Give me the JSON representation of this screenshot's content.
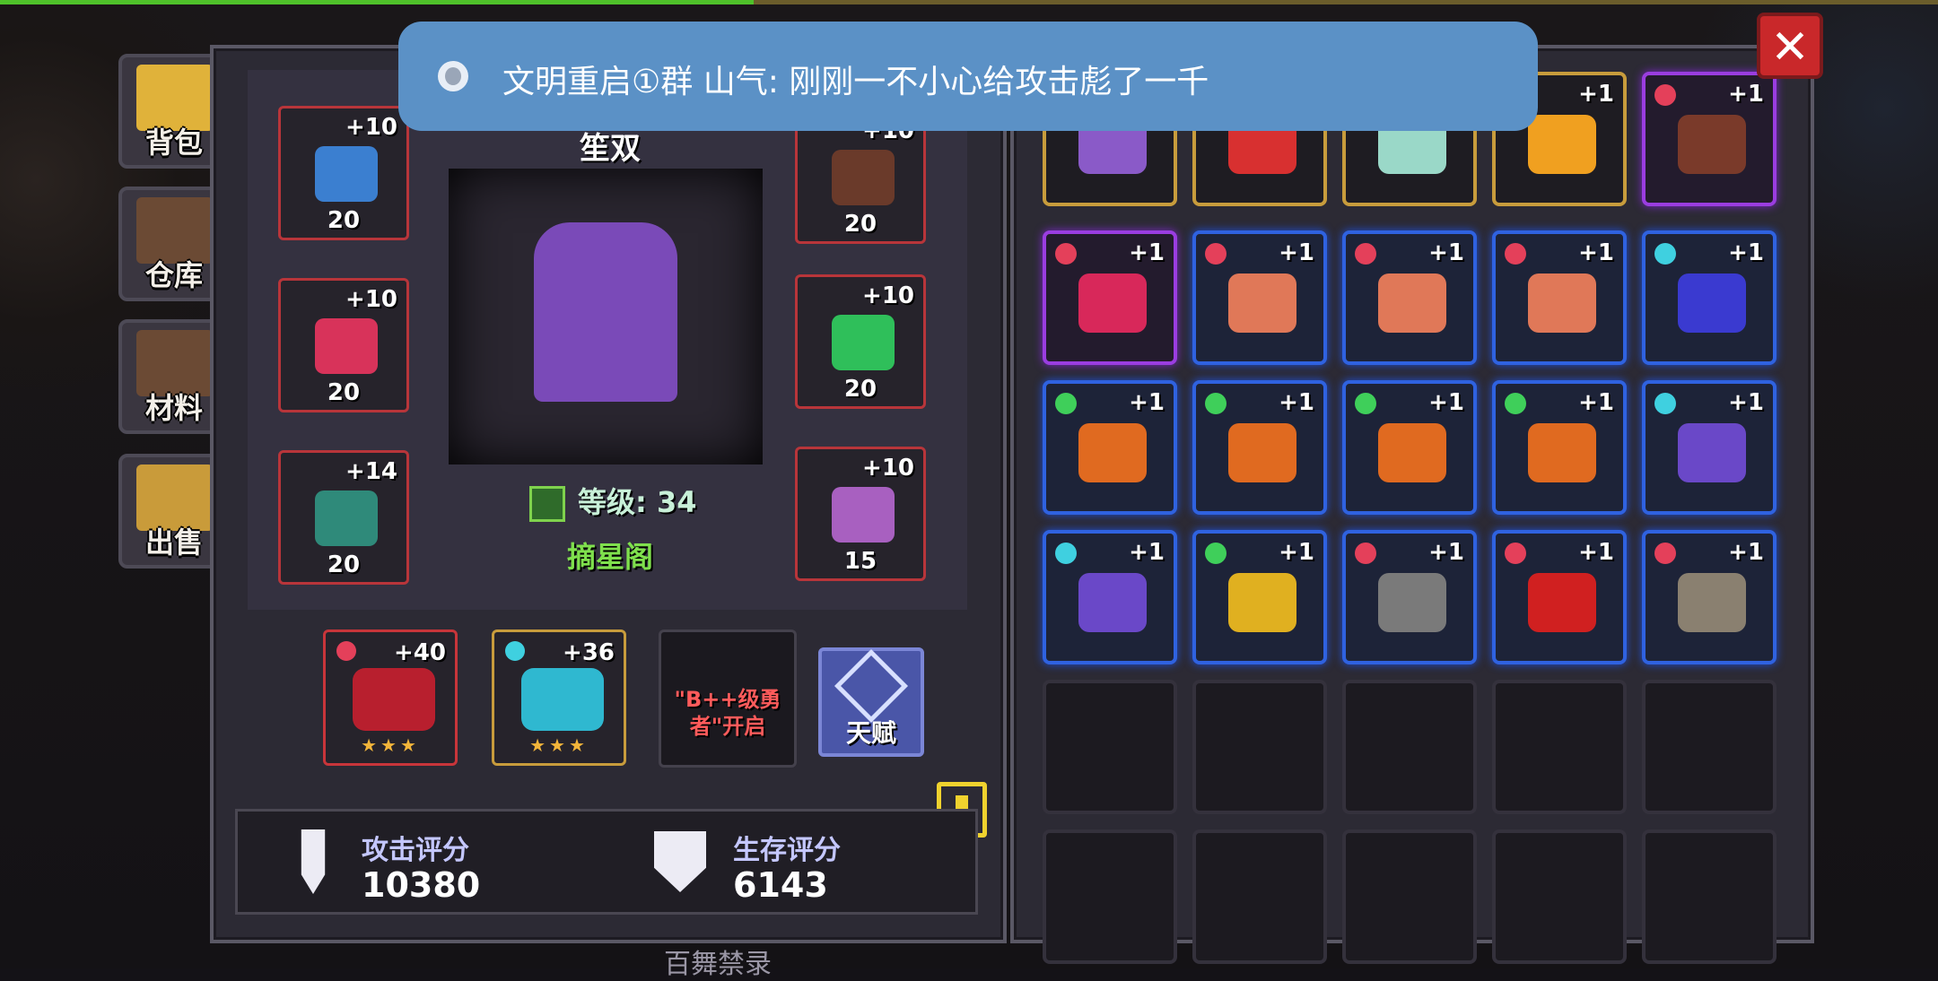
{
  "notification": {
    "text": "文明重启①群  山气: 刚刚一不小心给攻击彪了一千"
  },
  "side_tabs": [
    {
      "label": "背包",
      "color": "#e0b23a"
    },
    {
      "label": "仓库",
      "color": "#6b4a34"
    },
    {
      "label": "材料",
      "color": "#6b4a34"
    },
    {
      "label": "出售",
      "color": "#c99b3a"
    }
  ],
  "hero": {
    "name": "笙双",
    "level_label": "等级: 34",
    "guild": "摘星阁"
  },
  "equipment": [
    {
      "level": "+10",
      "count": "20",
      "color": "#3b7fd0"
    },
    {
      "level": "+10",
      "count": "20",
      "color": "#d8335a"
    },
    {
      "level": "+14",
      "count": "20",
      "color": "#2f8a7a"
    },
    {
      "level": "+10",
      "count": "20",
      "color": "#6a3a2a"
    },
    {
      "level": "+10",
      "count": "20",
      "color": "#2fbf5a"
    },
    {
      "level": "+10",
      "count": "15",
      "color": "#a860c0"
    }
  ],
  "weapons": [
    {
      "level": "+40",
      "stars": "★★★",
      "gem": "#e4405a",
      "color": "#b81f2e"
    },
    {
      "level": "+36",
      "stars": "★★★",
      "gem": "#3fd0e0",
      "color": "#2fb8d0"
    }
  ],
  "lock_slot": {
    "text": "\"B++级勇者\"开启"
  },
  "talent": {
    "label": "天赋"
  },
  "stats": {
    "attack_label": "攻击评分",
    "attack_value": "10380",
    "survival_label": "生存评分",
    "survival_value": "6143"
  },
  "inventory": [
    {
      "lvl": "",
      "frame": "gold",
      "gem": "",
      "color": "#8a5ac8"
    },
    {
      "lvl": "",
      "frame": "gold",
      "gem": "",
      "color": "#d83030"
    },
    {
      "lvl": "",
      "frame": "gold",
      "gem": "",
      "color": "#9ad8c8"
    },
    {
      "lvl": "+1",
      "frame": "gold",
      "gem": "",
      "color": "#f0a020"
    },
    {
      "lvl": "+1",
      "frame": "purple",
      "gem": "#e4405a",
      "color": "#7a3a2a"
    },
    {
      "lvl": "+1",
      "frame": "purple",
      "gem": "#e4405a",
      "color": "#d8285a"
    },
    {
      "lvl": "+1",
      "frame": "blue",
      "gem": "#e4405a",
      "color": "#e07858"
    },
    {
      "lvl": "+1",
      "frame": "blue",
      "gem": "#e4405a",
      "color": "#e07858"
    },
    {
      "lvl": "+1",
      "frame": "blue",
      "gem": "#e4405a",
      "color": "#e07858"
    },
    {
      "lvl": "+1",
      "frame": "blue",
      "gem": "#3fd0e0",
      "color": "#3a3ad0"
    },
    {
      "lvl": "+1",
      "frame": "blue",
      "gem": "#3fcf5a",
      "color": "#e06a20"
    },
    {
      "lvl": "+1",
      "frame": "blue",
      "gem": "#3fcf5a",
      "color": "#e06a20"
    },
    {
      "lvl": "+1",
      "frame": "blue",
      "gem": "#3fcf5a",
      "color": "#e06a20"
    },
    {
      "lvl": "+1",
      "frame": "blue",
      "gem": "#3fcf5a",
      "color": "#e06a20"
    },
    {
      "lvl": "+1",
      "frame": "blue",
      "gem": "#3fd0e0",
      "color": "#6a48c8"
    },
    {
      "lvl": "+1",
      "frame": "blue",
      "gem": "#3fd0e0",
      "color": "#6a48c8"
    },
    {
      "lvl": "+1",
      "frame": "blue",
      "gem": "#3fcf5a",
      "color": "#e0b020"
    },
    {
      "lvl": "+1",
      "frame": "blue",
      "gem": "#e4405a",
      "color": "#7a7a7a"
    },
    {
      "lvl": "+1",
      "frame": "blue",
      "gem": "#e4405a",
      "color": "#d02020"
    },
    {
      "lvl": "+1",
      "frame": "blue",
      "gem": "#e4405a",
      "color": "#8a8070"
    },
    {
      "lvl": "",
      "frame": "empty",
      "gem": "",
      "color": ""
    },
    {
      "lvl": "",
      "frame": "empty",
      "gem": "",
      "color": ""
    },
    {
      "lvl": "",
      "frame": "empty",
      "gem": "",
      "color": ""
    },
    {
      "lvl": "",
      "frame": "empty",
      "gem": "",
      "color": ""
    },
    {
      "lvl": "",
      "frame": "empty",
      "gem": "",
      "color": ""
    },
    {
      "lvl": "",
      "frame": "empty",
      "gem": "",
      "color": ""
    },
    {
      "lvl": "",
      "frame": "empty",
      "gem": "",
      "color": ""
    },
    {
      "lvl": "",
      "frame": "empty",
      "gem": "",
      "color": ""
    },
    {
      "lvl": "",
      "frame": "empty",
      "gem": "",
      "color": ""
    },
    {
      "lvl": "",
      "frame": "empty",
      "gem": "",
      "color": ""
    }
  ],
  "close_symbol": "✕",
  "floor_text": "百舞禁录"
}
